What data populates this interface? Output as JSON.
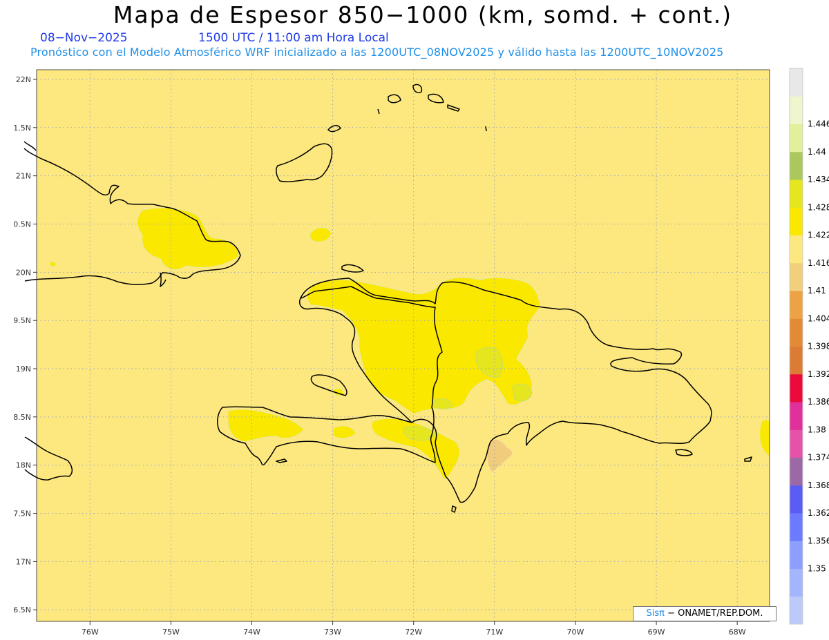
{
  "header": {
    "title": "Mapa de Espesor 850−1000 (km, somd. + cont.)",
    "date": "08−Nov−2025",
    "time": "1500 UTC / 11:00 am Hora Local",
    "subtitle": "Pronóstico con el Modelo Atmosférico WRF inicializado a las 1200UTC_08NOV2025 y válido hasta las  1200UTC_10NOV2025"
  },
  "map": {
    "lon_range": [
      -76.66,
      -67.6
    ],
    "lat_range": [
      16.38,
      22.1
    ],
    "background_fill": "#fde87f",
    "higher_fill": "#fbe800",
    "highest_fill": "#e6e61f",
    "lower_fill": "#f0cc7c",
    "coast_color": "#000000",
    "grid_style": "dotted",
    "lat_labels": [
      "22N",
      "1.5N",
      "21N",
      "0.5N",
      "20N",
      "9.5N",
      "19N",
      "8.5N",
      "18N",
      "7.5N",
      "17N",
      "6.5N"
    ],
    "lon_labels": [
      "76W",
      "75W",
      "74W",
      "73W",
      "72W",
      "71W",
      "70W",
      "69W",
      "68W"
    ]
  },
  "colorbar": {
    "labels": [
      "1.35",
      "1.356",
      "1.362",
      "1.368",
      "1.374",
      "1.38",
      "1.386",
      "1.392",
      "1.398",
      "1.404",
      "1.41",
      "1.416",
      "1.422",
      "1.428",
      "1.434",
      "1.44",
      "1.446"
    ],
    "colors": [
      "#bcc9fb",
      "#a2b5fd",
      "#8c9efe",
      "#6c7bfd",
      "#5c5cf4",
      "#9b6aa6",
      "#e453a7",
      "#e0309a",
      "#ea0a3c",
      "#dc7b34",
      "#e38a35",
      "#eca245",
      "#f2cf7c",
      "#fde87f",
      "#fbe800",
      "#e6e61f",
      "#aac85c",
      "#e2f09c",
      "#eff5cc",
      "#e8e8e8"
    ]
  },
  "credit": {
    "brand": "Sisπ",
    "org": " ONAMET/REP.DOM."
  }
}
